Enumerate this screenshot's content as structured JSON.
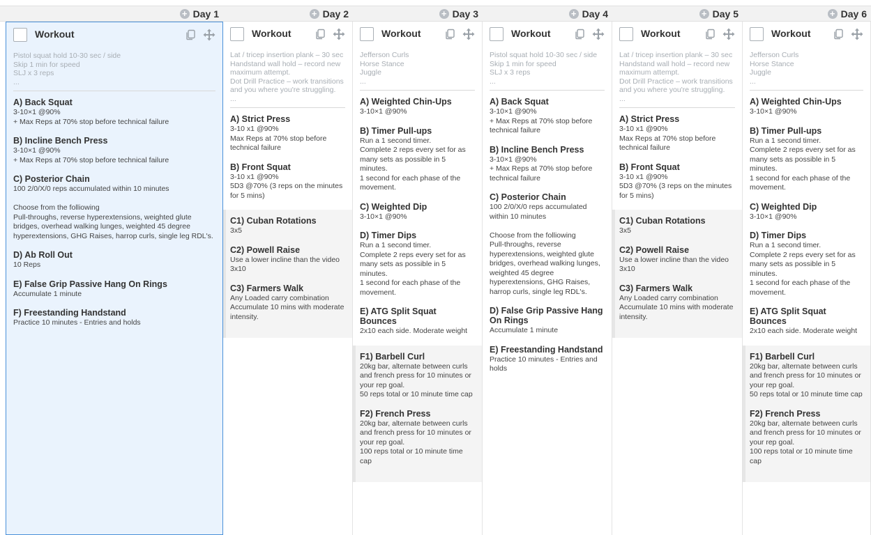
{
  "days": [
    {
      "label": "Day 1"
    },
    {
      "label": "Day 2"
    },
    {
      "label": "Day 3"
    },
    {
      "label": "Day 4"
    },
    {
      "label": "Day 5"
    },
    {
      "label": "Day 6"
    }
  ],
  "columns": [
    {
      "title": "Workout",
      "warmup": [
        "Pistol squat hold 10-30 sec / side",
        "Skip 1 min for speed",
        "SLJ x 3 reps",
        "..."
      ],
      "groups": [
        {
          "shaded": false,
          "items": [
            {
              "title": "A) Back Squat",
              "text": "3-10×1 @90%\n+ Max Reps at 70% stop before technical failure"
            },
            {
              "title": "B) Incline Bench Press",
              "text": "3-10×1 @90%\n+ Max Reps at 70% stop before technical failure"
            },
            {
              "title": "C) Posterior Chain",
              "text": "100 2/0/X/0 reps accumulated within 10 minutes\n\nChoose from the folliowing\nPull-throughs, reverse hyperextensions, weighted glute bridges, overhead walking lunges, weighted 45 degree hyperextensions, GHG Raises, harrop curls, single leg RDL's."
            },
            {
              "title": "D) Ab Roll Out",
              "text": "10 Reps"
            },
            {
              "title": "E) False Grip Passive Hang On Rings",
              "text": "Accumulate 1 minute"
            },
            {
              "title": "F) Freestanding Handstand",
              "text": "Practice 10 minutes - Entries and holds"
            }
          ]
        }
      ]
    },
    {
      "title": "Workout",
      "warmup": [
        "Lat / tricep insertion plank – 30 sec",
        "Handstand wall hold – record new maximum attempt.",
        "Dot Drill Practice – work transitions and you where you're struggling.",
        "..."
      ],
      "groups": [
        {
          "shaded": false,
          "items": [
            {
              "title": "A) Strict Press",
              "text": "3-10 x1 @90%\nMax Reps at 70% stop before technical failure"
            },
            {
              "title": "B) Front Squat",
              "text": "3-10 x1 @90%\n5D3 @70% (3 reps on the minutes for 5 mins)"
            }
          ]
        },
        {
          "shaded": true,
          "items": [
            {
              "title": "C1) Cuban Rotations",
              "text": "3x5"
            },
            {
              "title": "C2) Powell Raise",
              "text": "Use a lower incline than the video\n3x10"
            },
            {
              "title": "C3) Farmers Walk",
              "text": "Any Loaded carry combination\nAccumulate 10 mins with moderate intensity."
            }
          ]
        }
      ]
    },
    {
      "title": "Workout",
      "warmup": [
        "Jefferson Curls",
        "Horse Stance",
        "Juggle",
        "..."
      ],
      "groups": [
        {
          "shaded": false,
          "items": [
            {
              "title": "A) Weighted Chin-Ups",
              "text": "3-10×1 @90%"
            },
            {
              "title": "B) Timer Pull-ups",
              "text": "Run a 1 second timer.\nComplete 2 reps every set for as many sets as possible in 5 minutes.\n1 second for each phase of the movement."
            },
            {
              "title": "C) Weighted Dip",
              "text": "3-10×1 @90%"
            },
            {
              "title": "D) Timer Dips",
              "text": "Run a 1 second timer.\nComplete 2 reps every set for as many sets as possible in 5 minutes.\n1 second for each phase of the movement."
            },
            {
              "title": "E) ATG Split Squat Bounces",
              "text": "2x10 each side. Moderate weight"
            }
          ]
        },
        {
          "shaded": true,
          "items": [
            {
              "title": "F1) Barbell Curl",
              "text": "20kg bar, alternate between curls and french press for 10 minutes or your rep goal.\n50 reps total or 10 minute time cap"
            },
            {
              "title": "F2) French Press",
              "text": "20kg bar, alternate between curls and french press for 10 minutes or your rep goal.\n100 reps total or 10 minute time cap"
            }
          ]
        }
      ]
    },
    {
      "title": "Workout",
      "warmup": [
        "Pistol squat hold 10-30 sec / side",
        "Skip 1 min for speed",
        "SLJ x 3 reps",
        "..."
      ],
      "groups": [
        {
          "shaded": false,
          "items": [
            {
              "title": "A) Back Squat",
              "text": "3-10×1 @90%\n+ Max Reps at 70% stop before technical failure"
            },
            {
              "title": "B) Incline Bench Press",
              "text": "3-10×1 @90%\n+ Max Reps at 70% stop before technical failure"
            },
            {
              "title": "C) Posterior Chain",
              "text": "100 2/0/X/0 reps accumulated within 10 minutes\n\nChoose from the folliowing\nPull-throughs, reverse hyperextensions, weighted glute bridges, overhead walking lunges, weighted 45 degree hyperextensions, GHG Raises, harrop curls, single leg RDL's."
            },
            {
              "title": "D) False Grip Passive Hang On Rings",
              "text": "Accumulate 1 minute"
            },
            {
              "title": "E) Freestanding Handstand",
              "text": "Practice 10 minutes - Entries and holds"
            }
          ]
        }
      ]
    },
    {
      "title": "Workout",
      "warmup": [
        "Lat / tricep insertion plank – 30 sec",
        "Handstand wall hold – record new maximum attempt.",
        "Dot Drill Practice – work transitions and you where you're struggling.",
        "..."
      ],
      "groups": [
        {
          "shaded": false,
          "items": [
            {
              "title": "A) Strict Press",
              "text": "3-10 x1 @90%\nMax Reps at 70% stop before technical failure"
            },
            {
              "title": "B) Front Squat",
              "text": "3-10 x1 @90%\n5D3 @70% (3 reps on the minutes for 5 mins)"
            }
          ]
        },
        {
          "shaded": true,
          "items": [
            {
              "title": "C1) Cuban Rotations",
              "text": "3x5"
            },
            {
              "title": "C2) Powell Raise",
              "text": "Use a lower incline than the video\n3x10"
            },
            {
              "title": "C3) Farmers Walk",
              "text": "Any Loaded carry combination\nAccumulate 10 mins with moderate intensity."
            }
          ]
        }
      ]
    },
    {
      "title": "Workout",
      "warmup": [
        "Jefferson Curls",
        "Horse Stance",
        "Juggle",
        "..."
      ],
      "groups": [
        {
          "shaded": false,
          "items": [
            {
              "title": "A) Weighted Chin-Ups",
              "text": "3-10×1 @90%"
            },
            {
              "title": "B) Timer Pull-ups",
              "text": "Run a 1 second timer.\nComplete 2 reps every set for as many sets as possible in 5 minutes.\n1 second for each phase of the movement."
            },
            {
              "title": "C) Weighted Dip",
              "text": "3-10×1 @90%"
            },
            {
              "title": "D) Timer Dips",
              "text": "Run a 1 second timer.\nComplete 2 reps every set for as many sets as possible in 5 minutes.\n1 second for each phase of the movement."
            },
            {
              "title": "E) ATG Split Squat Bounces",
              "text": "2x10 each side. Moderate weight"
            }
          ]
        },
        {
          "shaded": true,
          "items": [
            {
              "title": "F1) Barbell Curl",
              "text": "20kg bar, alternate between curls and french press for 10 minutes or your rep goal.\n50 reps total or 10 minute time cap"
            },
            {
              "title": "F2) French Press",
              "text": "20kg bar, alternate between curls and french press for 10 minutes or your rep goal.\n100 reps total or 10 minute time cap"
            }
          ]
        }
      ]
    }
  ]
}
